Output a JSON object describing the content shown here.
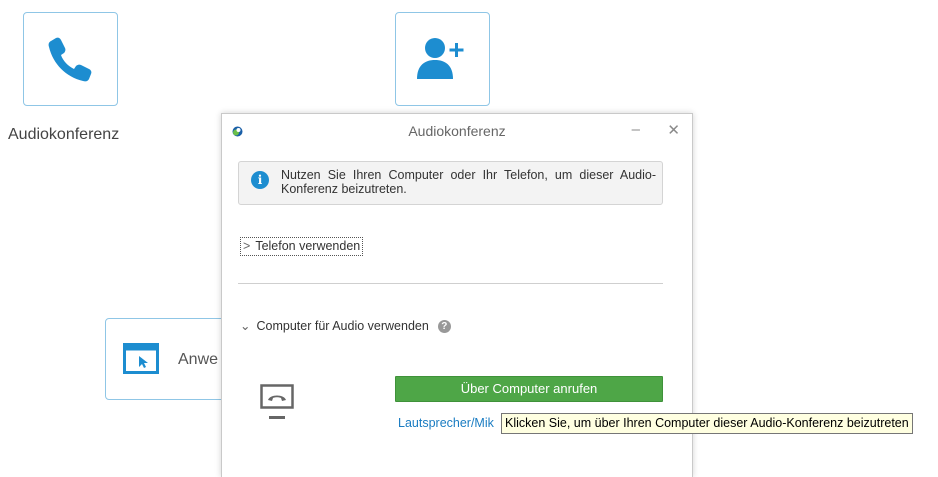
{
  "tiles": {
    "audio": {
      "caption": "Audiokonferenz",
      "icon": "phone-icon"
    },
    "invite": {
      "icon": "add-person-icon"
    },
    "app": {
      "caption": "Anwe",
      "icon": "application-window-icon"
    }
  },
  "dialog": {
    "title": "Audiokonferenz",
    "minimize_label": "–",
    "close_label": "✕",
    "info_text": "Nutzen Sie Ihren Computer oder Ihr Telefon, um dieser Audio-Konferenz beizutreten.",
    "phone_section": {
      "label": "Telefon verwenden",
      "expanded": false
    },
    "computer_section": {
      "label": "Computer für Audio verwenden",
      "expanded": true
    },
    "call_button": "Über Computer anrufen",
    "speaker_link": "Lautsprecher/Mik"
  },
  "tooltip": "Klicken Sie, um über Ihren Computer dieser Audio-Konferenz beizutreten",
  "colors": {
    "accent": "#1d8dd0",
    "tile_border": "#8fc6e6",
    "call_button": "#4ea647",
    "link": "#1a7cc2"
  }
}
